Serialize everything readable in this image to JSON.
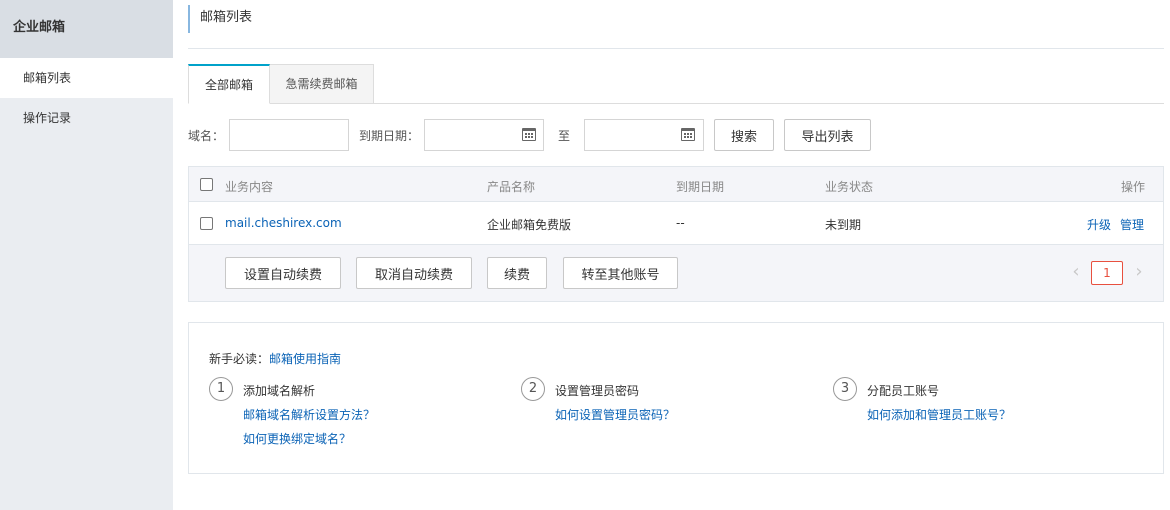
{
  "sidebar": {
    "title": "企业邮箱",
    "items": [
      {
        "label": "邮箱列表"
      },
      {
        "label": "操作记录"
      }
    ]
  },
  "header": {
    "title": "邮箱列表"
  },
  "tabs": [
    {
      "label": "全部邮箱"
    },
    {
      "label": "急需续费邮箱"
    }
  ],
  "filter": {
    "domain_label": "域名：",
    "domain_value": "",
    "expiry_label": "到期日期：",
    "date_from": "",
    "to_label": "至",
    "date_to": "",
    "search_label": "搜索",
    "export_label": "导出列表"
  },
  "table": {
    "columns": [
      "业务内容",
      "产品名称",
      "到期日期",
      "业务状态",
      "操作"
    ],
    "rows": [
      {
        "content": "mail.cheshirex.com",
        "product": "企业邮箱免费版",
        "expiry": "--",
        "status": "未到期",
        "actions": [
          "升级",
          "管理"
        ]
      }
    ],
    "footer_buttons": [
      "设置自动续费",
      "取消自动续费",
      "续费",
      "转至其他账号"
    ],
    "pagination": {
      "current": "1",
      "prev": "‹",
      "next": "›"
    }
  },
  "guide": {
    "prefix": "新手必读：",
    "link": "邮箱使用指南",
    "steps": [
      {
        "num": "1",
        "title": "添加域名解析",
        "links": [
          "邮箱域名解析设置方法？",
          "如何更换绑定域名？"
        ]
      },
      {
        "num": "2",
        "title": "设置管理员密码",
        "links": [
          "如何设置管理员密码？"
        ]
      },
      {
        "num": "3",
        "title": "分配员工账号",
        "links": [
          "如何添加和管理员工账号？"
        ]
      }
    ]
  },
  "colors": {
    "link": "#0b63b6",
    "tab_accent": "#00a2ca",
    "page_active": "#e8503f"
  }
}
